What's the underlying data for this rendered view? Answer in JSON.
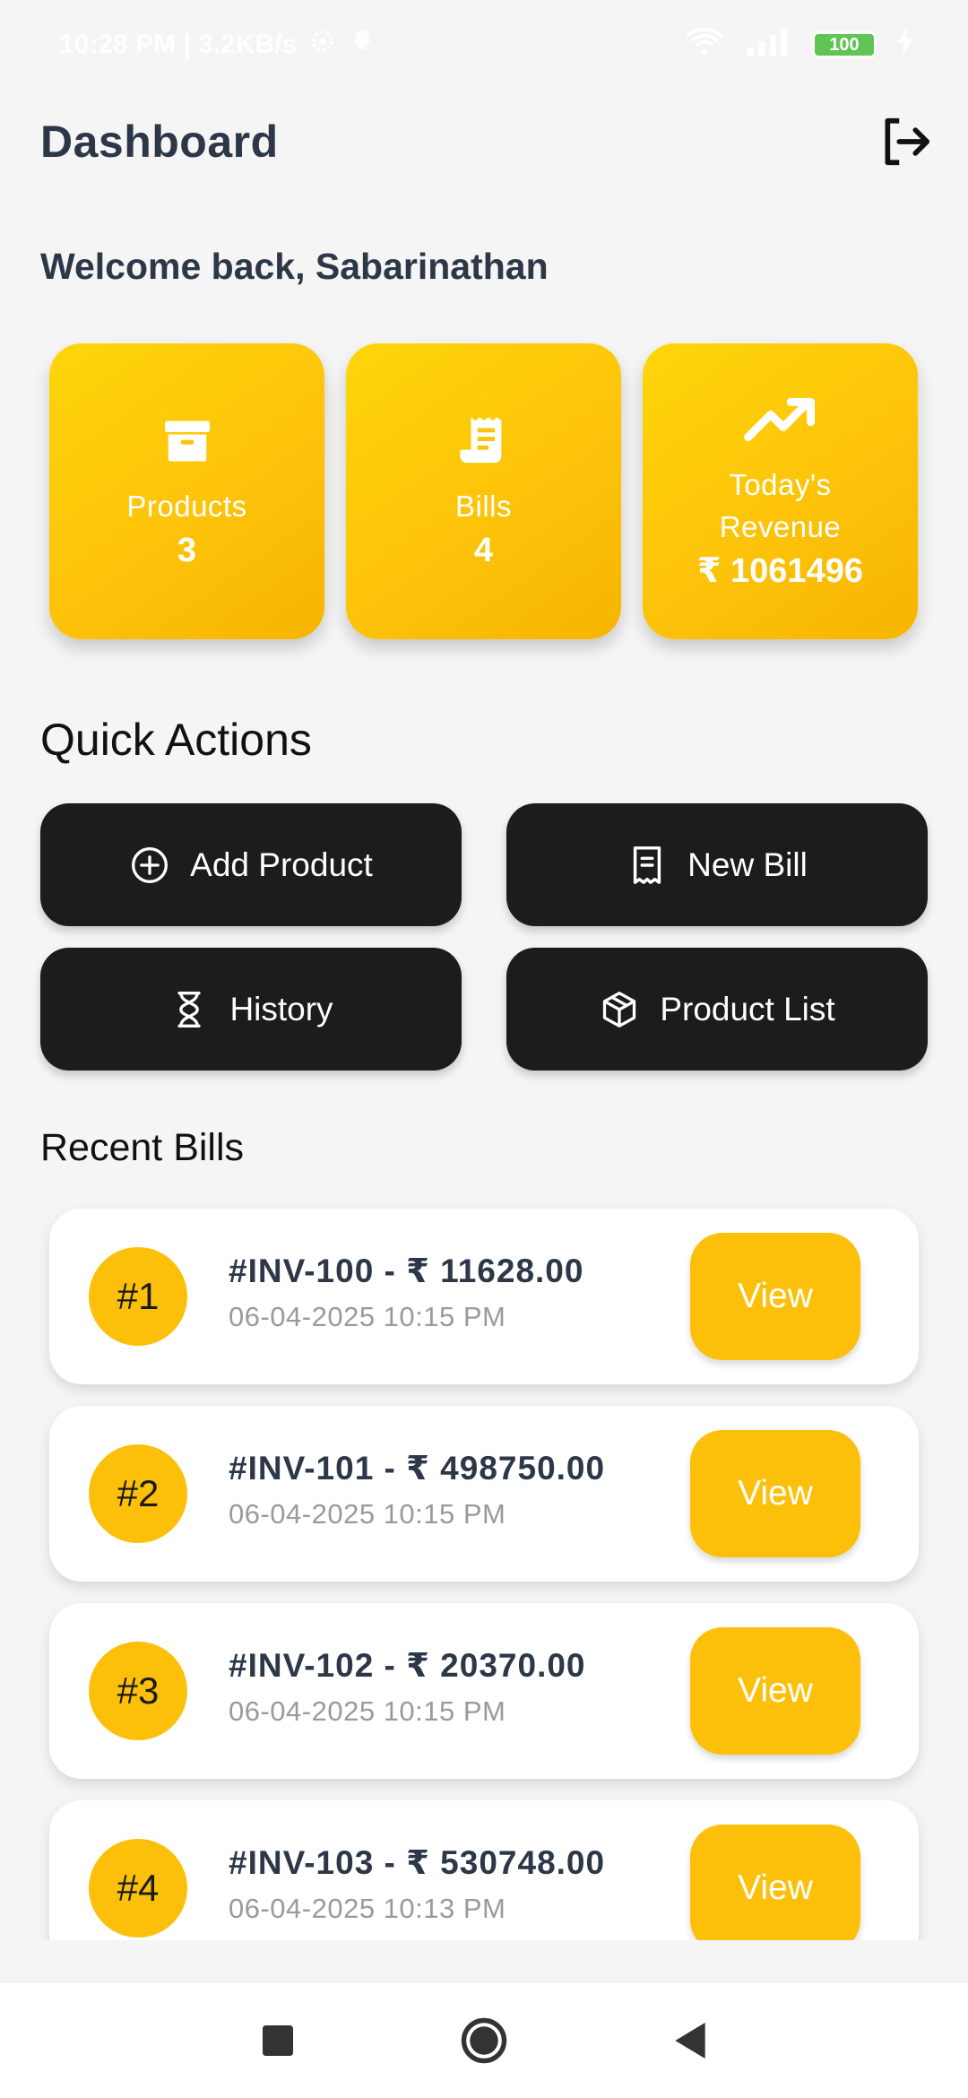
{
  "status_bar": {
    "time_text": "10:28 PM | 3.2KB/s",
    "battery": "100",
    "network": "4G"
  },
  "header": {
    "title": "Dashboard"
  },
  "welcome_text": "Welcome back, Sabarinathan",
  "stats": [
    {
      "label": "Products",
      "value": "3",
      "icon": "archive-box-icon"
    },
    {
      "label": "Bills",
      "value": "4",
      "icon": "receipt-icon"
    },
    {
      "label": "Today's Revenue",
      "value": "₹ 1061496",
      "icon": "trending-up-icon"
    }
  ],
  "quick_actions": {
    "title": "Quick Actions",
    "items": [
      {
        "label": "Add Product",
        "icon": "plus-circle-icon"
      },
      {
        "label": "New Bill",
        "icon": "receipt-icon"
      },
      {
        "label": "History",
        "icon": "hourglass-icon"
      },
      {
        "label": "Product List",
        "icon": "box-icon"
      }
    ]
  },
  "recent_bills": {
    "title": "Recent Bills",
    "view_label": "View",
    "items": [
      {
        "num": "#1",
        "title": "#INV-100 - ₹ 11628.00",
        "date": "06-04-2025 10:15 PM"
      },
      {
        "num": "#2",
        "title": "#INV-101 - ₹ 498750.00",
        "date": "06-04-2025 10:15 PM"
      },
      {
        "num": "#3",
        "title": "#INV-102 - ₹ 20370.00",
        "date": "06-04-2025 10:15 PM"
      },
      {
        "num": "#4",
        "title": "#INV-103 - ₹ 530748.00",
        "date": "06-04-2025 10:13 PM"
      }
    ]
  },
  "colors": {
    "accent": "#fdc00a",
    "dark": "#1c1c1c",
    "title": "#2c3748",
    "background": "#f5f5f5"
  }
}
